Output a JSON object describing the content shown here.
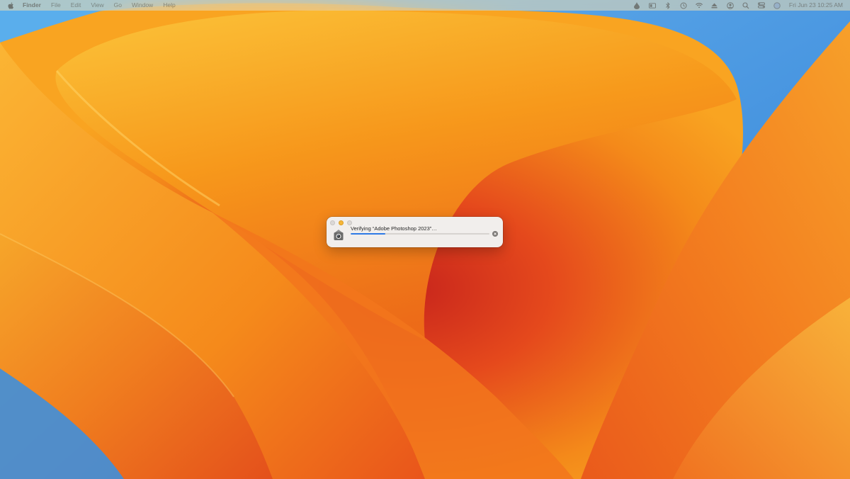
{
  "menubar": {
    "app_name": "Finder",
    "items": [
      "File",
      "Edit",
      "View",
      "Go",
      "Window",
      "Help"
    ],
    "status_icons": [
      "drop-icon",
      "display-icon",
      "bluetooth-icon",
      "time-machine-icon",
      "wifi-icon",
      "eject-icon",
      "user-icon",
      "search-icon",
      "control-center-icon",
      "siri-icon"
    ],
    "clock": "Fri Jun 23  10:25 AM"
  },
  "dialog": {
    "title": "Verifying “Adobe Photoshop 2023”…",
    "progress": 0.25,
    "app_icon": "gatekeeper-icon",
    "cancel_icon": "stop-icon",
    "accent_color": "#2f7ae5"
  },
  "wallpaper": {
    "name": "macOS Ventura",
    "colors": [
      "#f7a21b",
      "#ea5a1c",
      "#3a8ee0"
    ]
  }
}
